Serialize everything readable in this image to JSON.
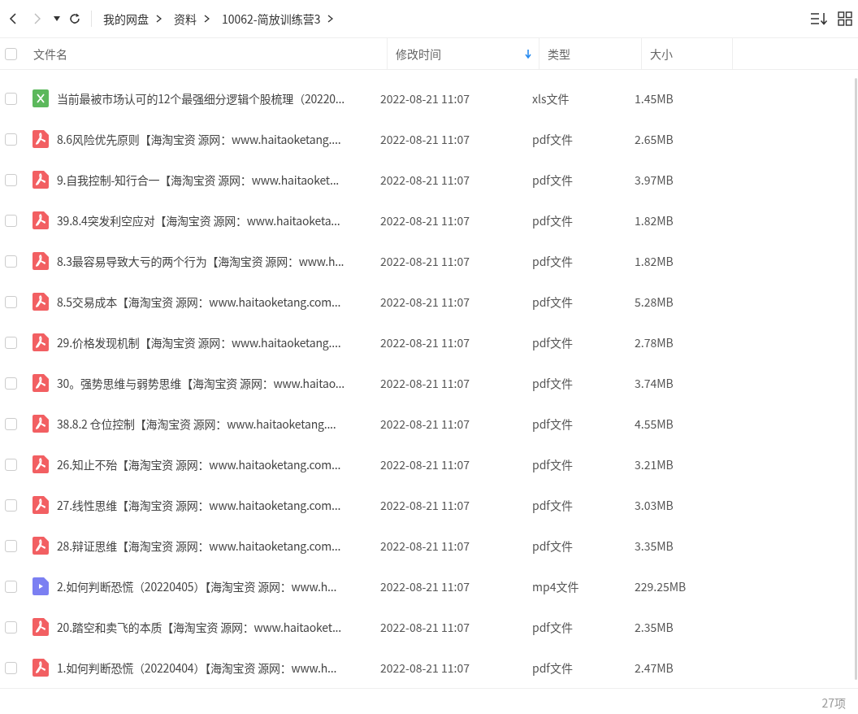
{
  "toolbar": {
    "breadcrumb": [
      "我的网盘",
      "资料",
      "10062-简放训练营3"
    ]
  },
  "table": {
    "select_all": {
      "checked": false
    },
    "columns": [
      {
        "label": "文件名",
        "sorted": false
      },
      {
        "label": "修改时间",
        "sorted": true
      },
      {
        "label": "类型",
        "sorted": false
      },
      {
        "label": "大小",
        "sorted": false
      }
    ],
    "rows": [
      {
        "kind": "xls",
        "checked": false,
        "name": "当前最被市场认可的12个最强细分逻辑个股梳理（20220...",
        "modified": "2022-08-21 11:07",
        "type": "xls文件",
        "size": "1.45MB"
      },
      {
        "kind": "pdf",
        "checked": false,
        "name": "8.6风险优先原则【海淘宝资 源网：www.haitaoketang....",
        "modified": "2022-08-21 11:07",
        "type": "pdf文件",
        "size": "2.65MB"
      },
      {
        "kind": "pdf",
        "checked": false,
        "name": "9.自我控制-知行合一【海淘宝资 源网：www.haitaoket...",
        "modified": "2022-08-21 11:07",
        "type": "pdf文件",
        "size": "3.97MB"
      },
      {
        "kind": "pdf",
        "checked": false,
        "name": "39.8.4突发利空应对【海淘宝资 源网：www.haitaoketa...",
        "modified": "2022-08-21 11:07",
        "type": "pdf文件",
        "size": "1.82MB"
      },
      {
        "kind": "pdf",
        "checked": false,
        "name": "8.3最容易导致大亏的两个行为【海淘宝资 源网：www.h...",
        "modified": "2022-08-21 11:07",
        "type": "pdf文件",
        "size": "1.82MB"
      },
      {
        "kind": "pdf",
        "checked": false,
        "name": "8.5交易成本【海淘宝资 源网：www.haitaoketang.com...",
        "modified": "2022-08-21 11:07",
        "type": "pdf文件",
        "size": "5.28MB"
      },
      {
        "kind": "pdf",
        "checked": false,
        "name": "29.价格发现机制【海淘宝资 源网：www.haitaoketang....",
        "modified": "2022-08-21 11:07",
        "type": "pdf文件",
        "size": "2.78MB"
      },
      {
        "kind": "pdf",
        "checked": false,
        "name": "30。强势思维与弱势思维【海淘宝资 源网：www.haitao...",
        "modified": "2022-08-21 11:07",
        "type": "pdf文件",
        "size": "3.74MB"
      },
      {
        "kind": "pdf",
        "checked": false,
        "name": "38.8.2 仓位控制【海淘宝资 源网：www.haitaoketang....",
        "modified": "2022-08-21 11:07",
        "type": "pdf文件",
        "size": "4.55MB"
      },
      {
        "kind": "pdf",
        "checked": false,
        "name": "26.知止不殆【海淘宝资 源网：www.haitaoketang.com...",
        "modified": "2022-08-21 11:07",
        "type": "pdf文件",
        "size": "3.21MB"
      },
      {
        "kind": "pdf",
        "checked": false,
        "name": "27.线性思维【海淘宝资 源网：www.haitaoketang.com...",
        "modified": "2022-08-21 11:07",
        "type": "pdf文件",
        "size": "3.03MB"
      },
      {
        "kind": "pdf",
        "checked": false,
        "name": "28.辩证思维【海淘宝资 源网：www.haitaoketang.com...",
        "modified": "2022-08-21 11:07",
        "type": "pdf文件",
        "size": "3.35MB"
      },
      {
        "kind": "video",
        "checked": false,
        "name": "2.如何判断恐慌（20220405）【海淘宝资 源网：www.h...",
        "modified": "2022-08-21 11:07",
        "type": "mp4文件",
        "size": "229.25MB"
      },
      {
        "kind": "pdf",
        "checked": false,
        "name": "20.踏空和卖飞的本质【海淘宝资 源网：www.haitaoket...",
        "modified": "2022-08-21 11:07",
        "type": "pdf文件",
        "size": "2.35MB"
      },
      {
        "kind": "pdf",
        "checked": false,
        "name": "1.如何判断恐慌（20220404）【海淘宝资 源网：www.h...",
        "modified": "2022-08-21 11:07",
        "type": "pdf文件",
        "size": "2.47MB"
      }
    ]
  },
  "status_bar": {
    "count": "27项"
  }
}
